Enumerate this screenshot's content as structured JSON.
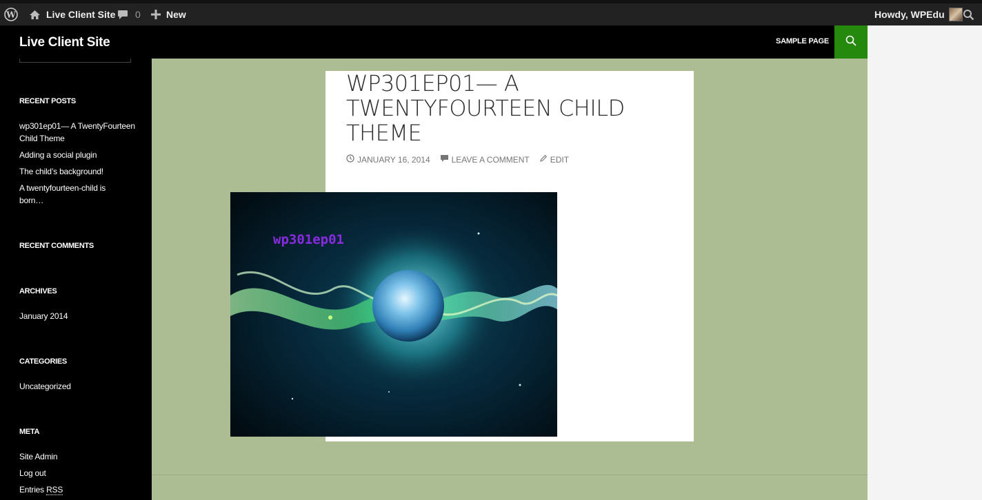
{
  "admin_bar": {
    "site_name": "Live Client Site",
    "comments_count": "0",
    "new_label": "New",
    "howdy": "Howdy, WPEdu"
  },
  "header": {
    "site_title": "Live Client Site",
    "nav": [
      {
        "label": "Sample Page"
      }
    ]
  },
  "sidebar": {
    "recent_posts": {
      "title": "Recent Posts",
      "items": [
        "wp301ep01— A TwentyFourteen Child Theme",
        "Adding a social plugin",
        "The child’s background!",
        "A twentyfourteen-child is born…"
      ]
    },
    "recent_comments": {
      "title": "Recent Comments"
    },
    "archives": {
      "title": "Archives",
      "items": [
        "January 2014"
      ]
    },
    "categories": {
      "title": "Categories",
      "items": [
        "Uncategorized"
      ]
    },
    "meta": {
      "title": "Meta",
      "items": [
        "Site Admin",
        "Log out",
        "Entries "
      ],
      "rss_abbr": "RSS"
    }
  },
  "article": {
    "title": "WP301EP01— A TWENTYFOURTEEN CHILD THEME",
    "date": "January 16, 2014",
    "comment_link": "Leave a comment",
    "edit_link": "Edit",
    "image_label": "wp301ep01"
  },
  "colors": {
    "accent_green": "#24890d",
    "content_bg": "#acbc93",
    "image_label": "#8a2be2"
  }
}
